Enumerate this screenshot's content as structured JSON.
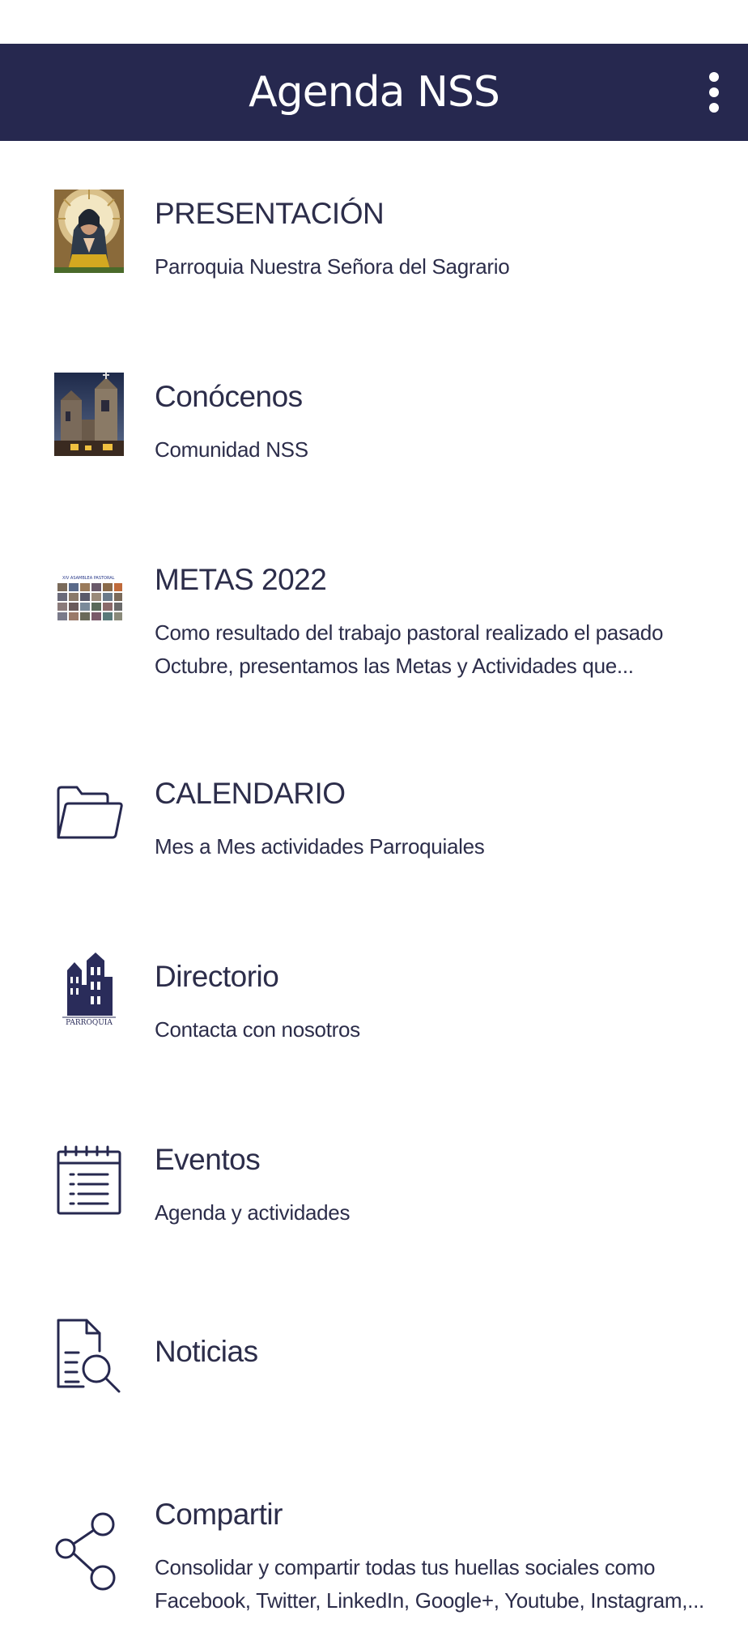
{
  "app_bar": {
    "title": "Agenda NSS",
    "overflow_icon": "more-vertical-icon",
    "background": "#26284f"
  },
  "menu": {
    "items": [
      {
        "id": "presentacion",
        "title": "PRESENTACIÓN",
        "subtitle": "Parroquia Nuestra Señora del Sagrario",
        "icon": "virgin-mary-photo"
      },
      {
        "id": "conocenos",
        "title": "Conócenos",
        "subtitle": "Comunidad NSS",
        "icon": "church-photo"
      },
      {
        "id": "metas-2022",
        "title": "METAS 2022",
        "subtitle": "Como resultado del trabajo pastoral realizado el pasado Octubre, presentamos las Metas y Actividades que...",
        "icon": "pastoral-assembly-collage"
      },
      {
        "id": "calendario",
        "title": "CALENDARIO",
        "subtitle": "Mes a Mes actividades Parroquiales",
        "icon": "folder-icon"
      },
      {
        "id": "directorio",
        "title": "Directorio",
        "subtitle": "Contacta con nosotros",
        "icon": "parroquia-logo"
      },
      {
        "id": "eventos",
        "title": "Eventos",
        "subtitle": "Agenda y actividades",
        "icon": "calendar-list-icon"
      },
      {
        "id": "noticias",
        "title": "Noticias",
        "subtitle": "",
        "icon": "document-search-icon"
      },
      {
        "id": "compartir",
        "title": "Compartir",
        "subtitle": "Consolidar y compartir todas tus huellas sociales como Facebook, Twitter, LinkedIn, Google+, Youtube, Instagram,...",
        "icon": "share-icon"
      }
    ]
  },
  "logo_text": {
    "metas_banner": "XIV ASAMBLEA PASTORAL",
    "parroquia_label": "PARROQUIA"
  },
  "colors": {
    "accent": "#26284f",
    "text": "#2c2d4a",
    "background": "#ffffff"
  }
}
